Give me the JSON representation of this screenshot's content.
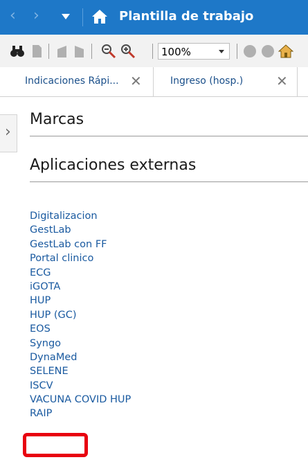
{
  "titlebar": {
    "title": "Plantilla de trabajo",
    "icons": [
      "back-arrow-icon",
      "forward-arrow-icon",
      "dropdown-icon",
      "home-icon"
    ]
  },
  "toolbar": {
    "icons": [
      "find-icon",
      "print-icon",
      "previous-page-icon",
      "next-page-icon",
      "zoom-out-icon",
      "zoom-in-icon",
      "circle-icon",
      "home-icon"
    ],
    "zoom_value": "100%"
  },
  "tabs": [
    {
      "label": "Indicaciones Rápi..."
    },
    {
      "label": "Ingreso (hosp.)"
    }
  ],
  "sections": {
    "marcas": "Marcas",
    "aplicaciones": "Aplicaciones externas"
  },
  "links": [
    "Digitalizacion",
    "GestLab",
    "GestLab con FF",
    "Portal clinico",
    "ECG",
    "iGOTA",
    "HUP",
    "HUP (GC)",
    "EOS",
    "Syngo",
    "DynaMed",
    "SELENE",
    "ISCV",
    "VACUNA COVID HUP",
    "RAIP"
  ],
  "colors": {
    "titlebar": "#1e78c8",
    "link": "#1a5aa0",
    "highlight": "#e8000f"
  }
}
